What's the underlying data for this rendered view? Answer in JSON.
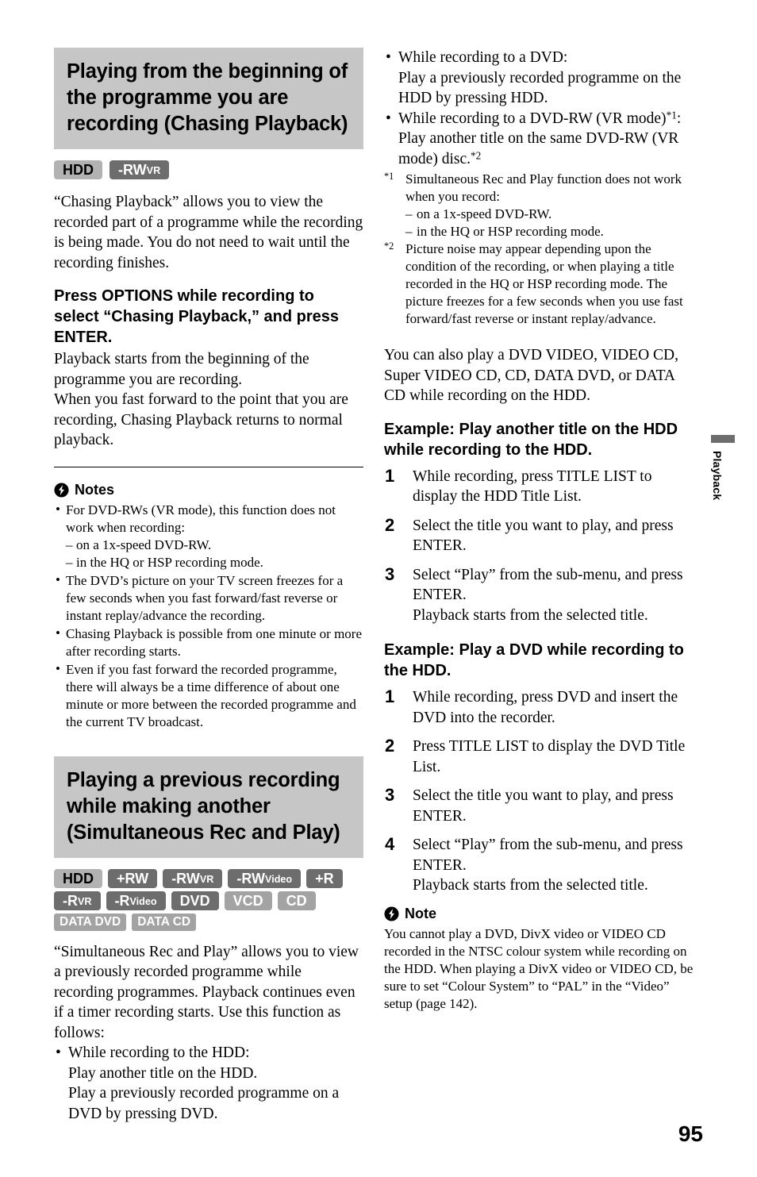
{
  "page": {
    "number": "95",
    "side_tab_label": "Playback"
  },
  "left_column": {
    "section1": {
      "heading": "Playing from the beginning of the programme you are recording (Chasing Playback)",
      "badges": [
        {
          "main": "HDD",
          "sub": "",
          "style": "light",
          "size": "lg"
        },
        {
          "main": "-RW",
          "sub": "VR",
          "style": "dark",
          "size": "lg"
        }
      ],
      "intro": "“Chasing Playback” allows you to view the recorded part of a programme while the recording is being made. You do not need to wait until the recording finishes.",
      "sub_heading": "Press OPTIONS while recording to select “Chasing Playback,” and press ENTER.",
      "sub_body": "Playback starts from the beginning of the programme you are recording.\nWhen you fast forward to the point that you are recording, Chasing Playback returns to normal playback.",
      "notes_title": "Notes",
      "notes": [
        {
          "text": "For DVD-RWs (VR mode), this function does not work when recording:",
          "dashes": [
            "on a 1x-speed DVD-RW.",
            "in the HQ or HSP recording mode."
          ]
        },
        {
          "text": "The DVD’s picture on your TV screen freezes for a few seconds when you fast forward/fast reverse or instant replay/advance the recording.",
          "dashes": []
        },
        {
          "text": "Chasing Playback is possible from one minute or more after recording starts.",
          "dashes": []
        },
        {
          "text": "Even if you fast forward the recorded programme, there will always be a time difference of about one minute or more between the recorded programme and the current TV broadcast.",
          "dashes": []
        }
      ]
    },
    "section2": {
      "heading": "Playing a previous recording while making another (Simultaneous Rec and Play)",
      "badges_row1": [
        {
          "main": "HDD",
          "sub": "",
          "style": "light",
          "size": "lg"
        },
        {
          "main": "+RW",
          "sub": "",
          "style": "dark",
          "size": "lg"
        },
        {
          "main": "-RW",
          "sub": "VR",
          "style": "dark",
          "size": "lg"
        },
        {
          "main": "-RW",
          "sub": "Video",
          "style": "dark",
          "size": "lg"
        },
        {
          "main": "+R",
          "sub": "",
          "style": "dark",
          "size": "lg"
        }
      ],
      "badges_row2": [
        {
          "main": "-R",
          "sub": "VR",
          "style": "dark",
          "size": "lg"
        },
        {
          "main": "-R",
          "sub": "Video",
          "style": "dark",
          "size": "lg"
        },
        {
          "main": "DVD",
          "sub": "",
          "style": "dark",
          "size": "lg"
        },
        {
          "main": "VCD",
          "sub": "",
          "style": "mid",
          "size": "lg"
        },
        {
          "main": "CD",
          "sub": "",
          "style": "mid",
          "size": "lg"
        }
      ],
      "badges_row3": [
        {
          "main": "DATA DVD",
          "sub": "",
          "style": "mid",
          "size": "sm"
        },
        {
          "main": "DATA CD",
          "sub": "",
          "style": "mid",
          "size": "sm"
        }
      ],
      "intro": "“Simultaneous Rec and Play” allows you to view a previously recorded programme while recording programmes. Playback continues even if a timer recording starts. Use this function as follows:",
      "bullets": [
        {
          "text": "While recording to the HDD:",
          "sup": "",
          "tail": "",
          "lines": [
            "Play another title on the HDD.",
            "Play a previously recorded programme on a DVD by pressing DVD."
          ]
        }
      ]
    }
  },
  "right_column": {
    "bullets": [
      {
        "text": "While recording to a DVD:",
        "sup": "",
        "tail": "",
        "lines": [
          "Play a previously recorded programme on the HDD by pressing HDD."
        ]
      },
      {
        "text": "While recording to a DVD-RW (VR mode)",
        "sup": "*1",
        "tail": ":",
        "lines": [
          "Play another title on the same DVD-RW (VR mode) disc."
        ],
        "lines_sup": "*2"
      }
    ],
    "footnotes": [
      {
        "mark": "*1",
        "text": "Simultaneous Rec and Play function does not work when you record:",
        "dashes": [
          "on a 1x-speed DVD-RW.",
          "in the HQ or HSP recording mode."
        ]
      },
      {
        "mark": "*2",
        "text": "Picture noise may appear depending upon the condition of the recording, or when playing a title recorded in the HQ or HSP recording mode. The picture freezes for a few seconds when you use fast forward/fast reverse or instant replay/advance.",
        "dashes": []
      }
    ],
    "paragraph": "You can also play a DVD VIDEO, VIDEO CD, Super VIDEO CD, CD, DATA DVD, or DATA CD while recording on the HDD.",
    "example1": {
      "heading": "Example: Play another title on the HDD while recording to the HDD.",
      "steps": [
        {
          "num": "1",
          "text": "While recording, press TITLE LIST to display the HDD Title List."
        },
        {
          "num": "2",
          "text": "Select the title you want to play, and press ENTER."
        },
        {
          "num": "3",
          "text": "Select “Play” from the sub-menu, and press ENTER.\nPlayback starts from the selected title."
        }
      ]
    },
    "example2": {
      "heading": "Example: Play a DVD while recording to the HDD.",
      "steps": [
        {
          "num": "1",
          "text": "While recording, press DVD and insert the DVD into the recorder."
        },
        {
          "num": "2",
          "text": "Press TITLE LIST to display the DVD Title List."
        },
        {
          "num": "3",
          "text": "Select the title you want to play, and press ENTER."
        },
        {
          "num": "4",
          "text": "Select “Play” from the sub-menu, and press ENTER.\nPlayback starts from the selected title."
        }
      ]
    },
    "note_title": "Note",
    "note_body": "You cannot play a DVD, DivX video or VIDEO CD recorded in the NTSC colour system while recording on the HDD. When playing a DivX video or VIDEO CD, be sure to set “Colour System” to “PAL” in the “Video” setup (page 142)."
  },
  "colors": {
    "header_bg": "#c6c6c6",
    "badge_light": "#b2b2b2",
    "badge_dark": "#6d6d6d",
    "badge_mid": "#a3a3a3",
    "text": "#000000"
  }
}
